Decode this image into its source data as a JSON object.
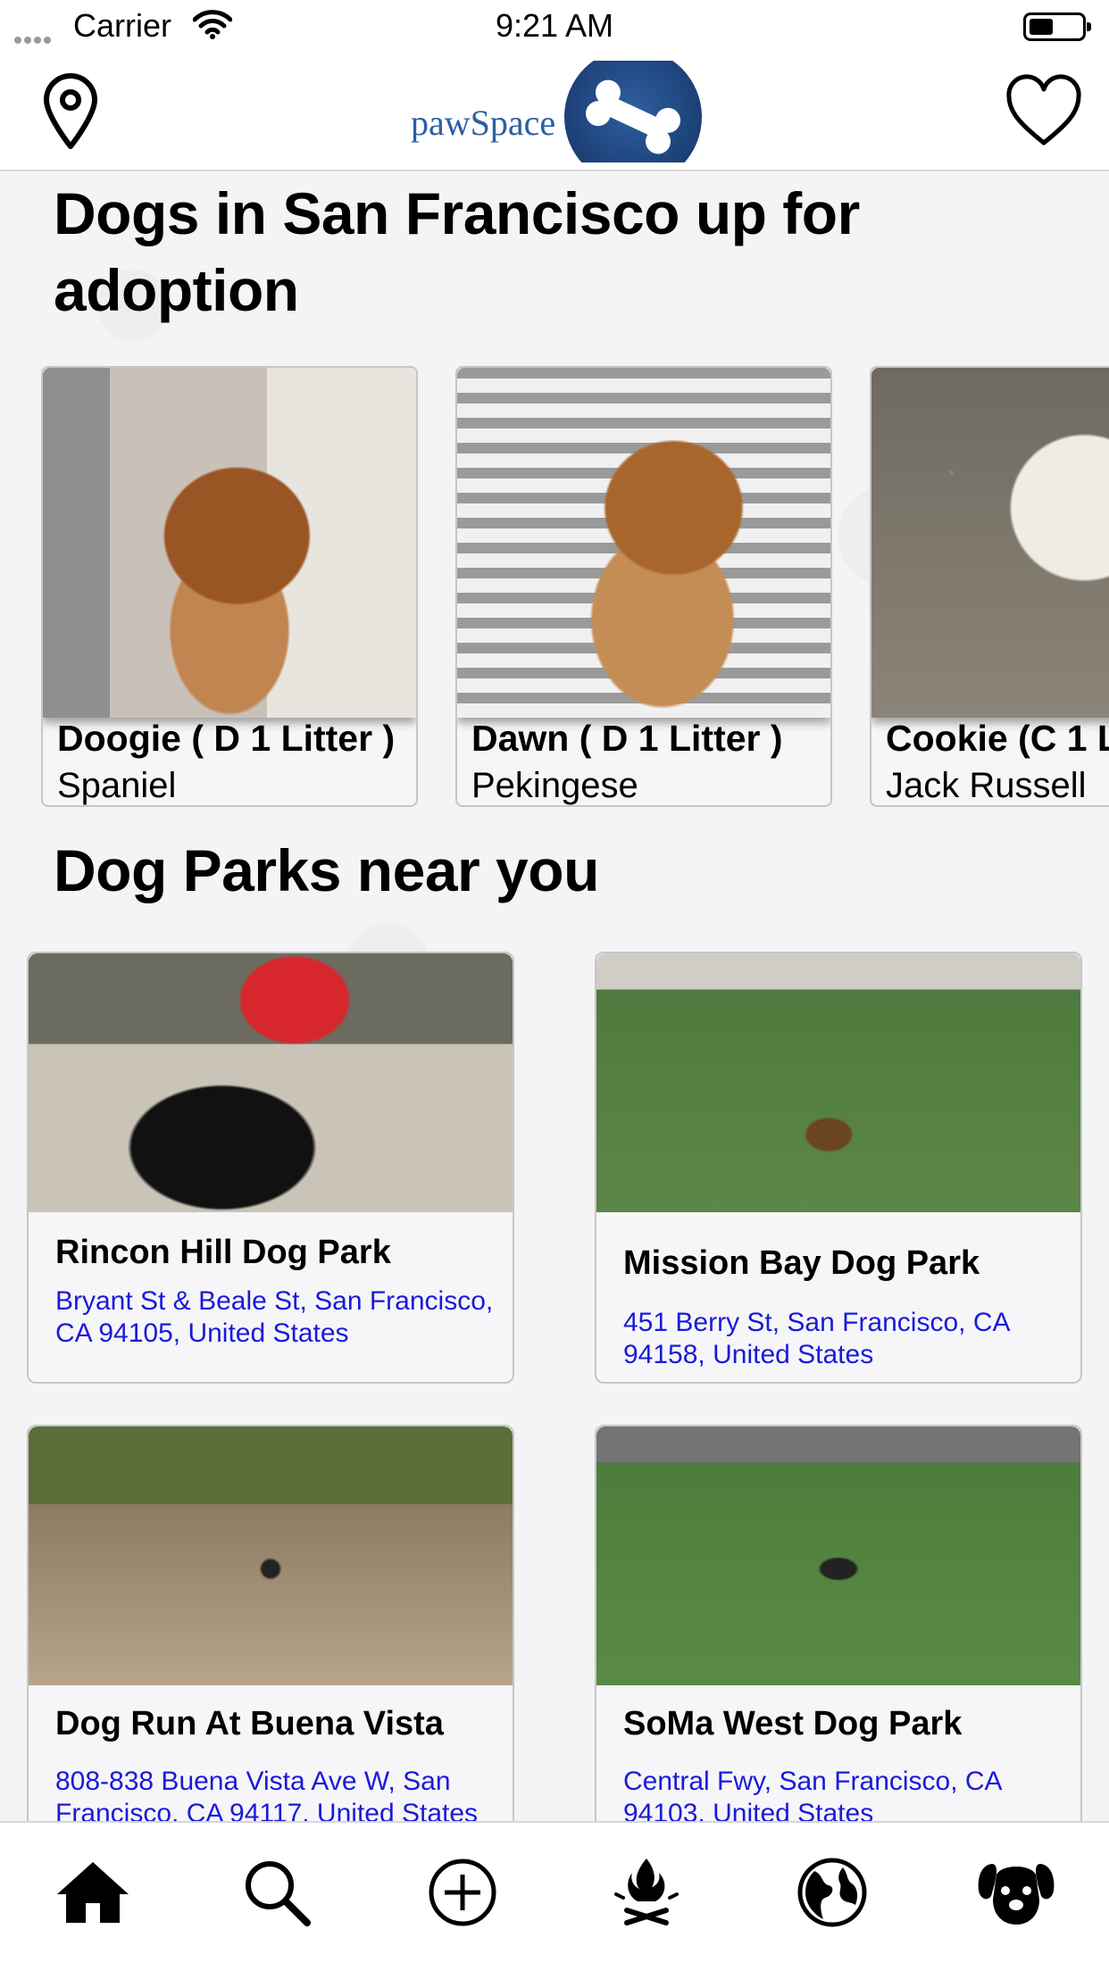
{
  "status_bar": {
    "carrier": "Carrier",
    "time": "9:21 AM"
  },
  "nav": {
    "logo_text": "pawSpace",
    "left_icon": "map-pin-icon",
    "right_icon": "heart-icon"
  },
  "adoption": {
    "title": "Dogs in San Francisco up for adoption",
    "dogs": [
      {
        "name": "Doogie ( D 1 Litter )",
        "breed": "Spaniel"
      },
      {
        "name": "Dawn ( D 1 Litter )",
        "breed": "Pekingese"
      },
      {
        "name": "Cookie (C 1 L",
        "breed": "Jack Russell"
      }
    ]
  },
  "parks": {
    "title": "Dog Parks near you",
    "items": [
      {
        "name": "Rincon Hill Dog Park",
        "address": "Bryant St & Beale St, San Francisco, CA 94105, United States"
      },
      {
        "name": "Mission Bay Dog Park",
        "address": "451 Berry St, San Francisco, CA 94158, United States"
      },
      {
        "name": "Dog Run At Buena Vista",
        "address": "808-838 Buena Vista Ave W, San Francisco, CA 94117, United States"
      },
      {
        "name": "SoMa West Dog Park",
        "address": "Central Fwy, San Francisco, CA 94103, United States"
      }
    ]
  },
  "tab_bar": {
    "tabs": [
      {
        "icon": "home-icon"
      },
      {
        "icon": "search-icon"
      },
      {
        "icon": "add-circle-icon"
      },
      {
        "icon": "campfire-icon"
      },
      {
        "icon": "globe-icon"
      },
      {
        "icon": "dog-face-icon"
      }
    ]
  }
}
